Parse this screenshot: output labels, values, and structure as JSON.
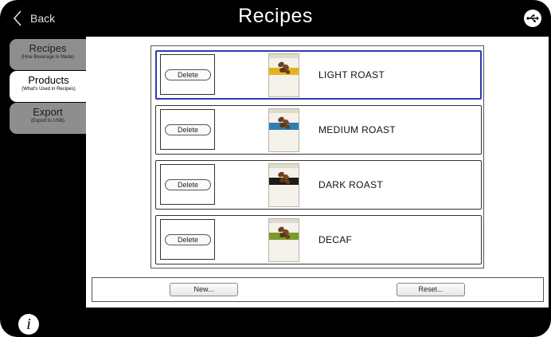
{
  "header": {
    "back_label": "Back",
    "title": "Recipes",
    "usb_icon": "usb-icon"
  },
  "sidebar": {
    "tabs": [
      {
        "title": "Recipes",
        "subtitle": "(How Beverage Is Made)",
        "active": false
      },
      {
        "title": "Products",
        "subtitle": "(What's Used in Recipes)",
        "active": true
      },
      {
        "title": "Export",
        "subtitle": "(Export to USB)",
        "active": false
      }
    ]
  },
  "products": {
    "delete_label": "Delete",
    "items": [
      {
        "name": "LIGHT ROAST",
        "band_color": "#e8b21c",
        "selected": true
      },
      {
        "name": "MEDIUM ROAST",
        "band_color": "#2f7fb5",
        "selected": false
      },
      {
        "name": "DARK ROAST",
        "band_color": "#1e1a18",
        "selected": false
      },
      {
        "name": "DECAF",
        "band_color": "#7c9a2e",
        "selected": false
      }
    ]
  },
  "footer": {
    "new_label": "New...",
    "reset_label": "Reset..."
  },
  "info_icon": "info-icon",
  "colors": {
    "selection_border": "#2e3ab4",
    "inactive_tab": "#8e8e8e"
  }
}
